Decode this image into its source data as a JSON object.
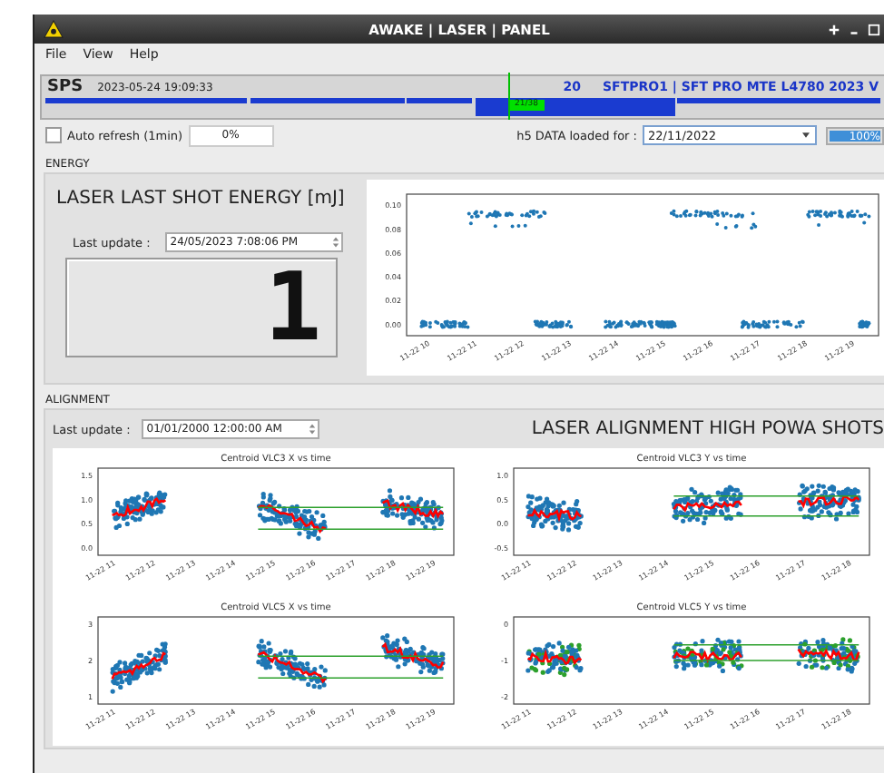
{
  "window": {
    "title": "AWAKE | LASER | PANEL"
  },
  "menu": [
    "File",
    "View",
    "Help"
  ],
  "status": {
    "machine": "SPS",
    "timestamp": "2023-05-24 19:09:33",
    "user_number": "20",
    "cycle_name": "SFTPRO1 | SFT PRO MTE L4780 2023 V",
    "cycle_position": "21/38"
  },
  "toolbar": {
    "auto_refresh": {
      "label": "Auto refresh (1min)",
      "checked": false
    },
    "refresh_progress": "0%",
    "h5_label": "h5 DATA loaded for :",
    "h5_date": "22/11/2022",
    "load_progress": {
      "text": "100%",
      "level": 1
    }
  },
  "energy": {
    "section": "ENERGY",
    "title": "LASER LAST SHOT ENERGY [mJ]",
    "last_update_label": "Last update :",
    "last_update": "24/05/2023 7:08:06 PM",
    "lcd_value": "1",
    "plot": {
      "yticks": [
        "0.10",
        "0.08",
        "0.06",
        "0.04",
        "0.02",
        "0.00"
      ],
      "xticks": [
        "11-22 10",
        "11-22 11",
        "11-22 12",
        "11-22 13",
        "11-22 14",
        "11-22 15",
        "11-22 16",
        "11-22 17",
        "11-22 18",
        "11-22 19"
      ]
    }
  },
  "alignment": {
    "section": "ALIGNMENT",
    "last_update_label": "Last update :",
    "last_update": "01/01/2000 12:00:00 AM",
    "title": "LASER ALIGNMENT HIGH POWA SHOTS",
    "plots": [
      {
        "title": "Centroid VLC3 X vs time",
        "yticks": [
          "1.5",
          "1.0",
          "0.5",
          "0.0"
        ],
        "xticks": [
          "11-22 11",
          "11-22 12",
          "11-22 13",
          "11-22 14",
          "11-22 15",
          "11-22 16",
          "11-22 17",
          "11-22 18",
          "11-22 19"
        ]
      },
      {
        "title": "Centroid VLC3 Y vs time",
        "yticks": [
          "1.0",
          "0.5",
          "0.0",
          "-0.5"
        ],
        "xticks": [
          "11-22 11",
          "11-22 12",
          "11-22 13",
          "11-22 14",
          "11-22 15",
          "11-22 16",
          "11-22 17",
          "11-22 18"
        ]
      },
      {
        "title": "Centroid VLC5 X vs time",
        "yticks": [
          "3",
          "2",
          "1"
        ],
        "xticks": [
          "11-22 11",
          "11-22 12",
          "11-22 13",
          "11-22 14",
          "11-22 15",
          "11-22 16",
          "11-22 17",
          "11-22 18",
          "11-22 19"
        ]
      },
      {
        "title": "Centroid VLC5 Y vs time",
        "yticks": [
          "0",
          "-1",
          "-2"
        ],
        "xticks": [
          "11-22 11",
          "11-22 12",
          "11-22 13",
          "11-22 14",
          "11-22 15",
          "11-22 16",
          "11-22 17",
          "11-22 18"
        ]
      }
    ]
  }
}
